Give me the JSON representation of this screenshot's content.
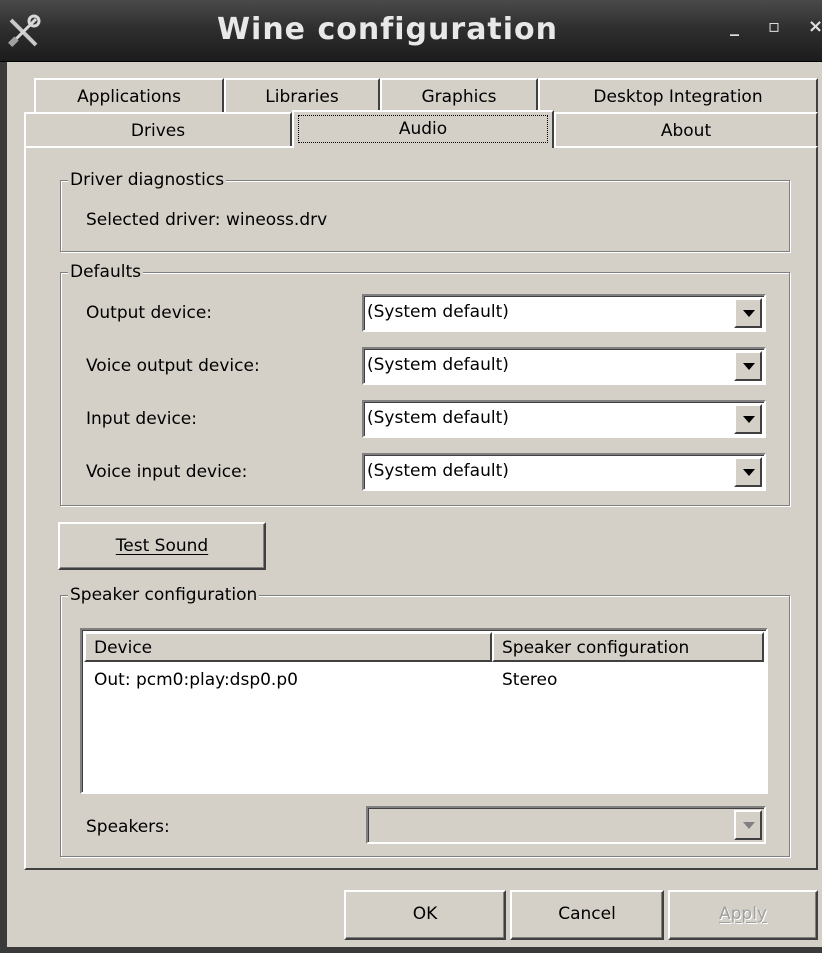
{
  "window": {
    "title": "Wine configuration",
    "icon": "wine-config-tools-icon",
    "minimize": "_",
    "maximize": "▫",
    "close": "×"
  },
  "tabs": {
    "row1": [
      "Applications",
      "Libraries",
      "Graphics",
      "Desktop Integration"
    ],
    "row2": [
      "Drives",
      "Audio",
      "About"
    ],
    "selected": "Audio"
  },
  "driver_diagnostics": {
    "legend": "Driver diagnostics",
    "text": "Selected driver: wineoss.drv"
  },
  "defaults": {
    "legend": "Defaults",
    "rows": [
      {
        "label": "Output device:",
        "value": "(System default)"
      },
      {
        "label": "Voice output device:",
        "value": "(System default)"
      },
      {
        "label": "Input device:",
        "value": "(System default)"
      },
      {
        "label": "Voice input device:",
        "value": "(System default)"
      }
    ]
  },
  "test_sound": {
    "label": "Test Sound",
    "mnemonic": "T"
  },
  "speaker_config": {
    "legend": "Speaker configuration",
    "columns": [
      "Device",
      "Speaker configuration"
    ],
    "rows": [
      {
        "device": "Out: pcm0:play:dsp0.p0",
        "config": "Stereo"
      }
    ],
    "speakers_label": "Speakers:",
    "speakers_value": ""
  },
  "footer": {
    "ok": "OK",
    "cancel": "Cancel",
    "apply": "Apply"
  },
  "colors": {
    "face": "#d4d0c8",
    "titlebar": "#2f2f2f",
    "title_text": "#e8e8e8"
  }
}
